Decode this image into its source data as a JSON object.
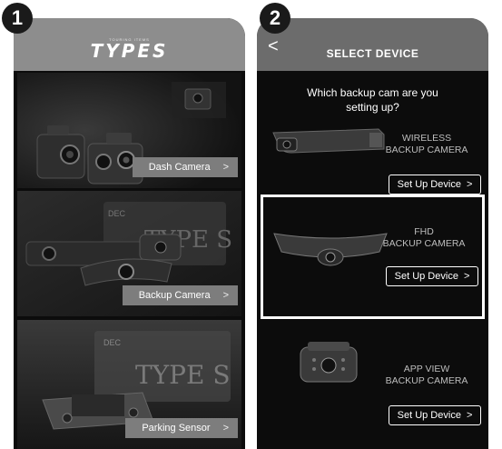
{
  "steps": [
    "1",
    "2"
  ],
  "screen1": {
    "logo_small": "TOURING ITEMS",
    "logo_main": "TYPES",
    "tiles": [
      {
        "label": "Dash Camera",
        "selected": false
      },
      {
        "label": "Backup Camera",
        "selected": true
      },
      {
        "label": "Parking Sensor",
        "selected": false
      }
    ]
  },
  "screen2": {
    "title": "SELECT DEVICE",
    "question": "Which backup cam are you setting up?",
    "devices": [
      {
        "name_line1": "WIRELESS",
        "name_line2": "BACKUP CAMERA",
        "button": "Set Up Device",
        "selected": false
      },
      {
        "name_line1": "FHD",
        "name_line2": "BACKUP CAMERA",
        "button": "Set Up Device",
        "selected": true
      },
      {
        "name_line1": "APP VIEW",
        "name_line2": "BACKUP CAMERA",
        "button": "Set Up Device",
        "selected": false
      }
    ]
  },
  "icons": {
    "back": "chevron-left-icon",
    "chevron": "chevron-right-icon"
  },
  "colors": {
    "header_gray": "#8d8d8d",
    "screen_bg": "#0c0c0c",
    "label_gray": "#7d7d7d"
  }
}
